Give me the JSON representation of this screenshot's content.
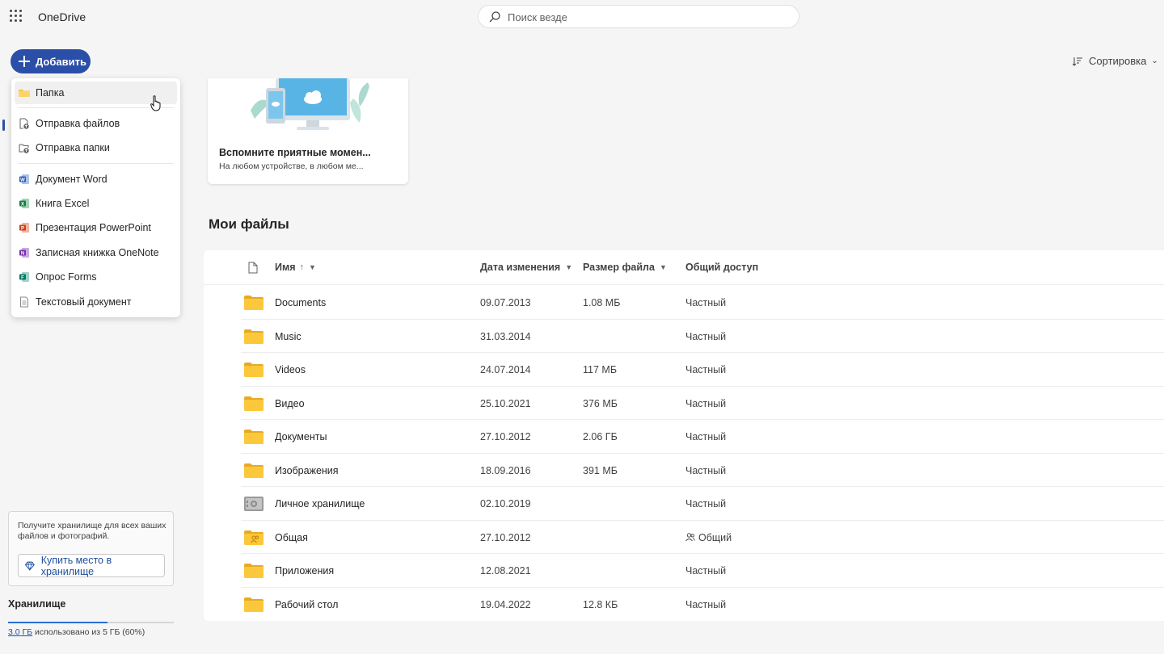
{
  "app": {
    "name": "OneDrive"
  },
  "search": {
    "placeholder": "Поиск везде"
  },
  "toolbar": {
    "add_label": "Добавить",
    "sort_label": "Сортировка"
  },
  "menu": {
    "items": [
      {
        "label": "Папка",
        "icon": "folder-icon"
      },
      {
        "label": "Отправка файлов",
        "icon": "file-upload-icon"
      },
      {
        "label": "Отправка папки",
        "icon": "folder-upload-icon"
      },
      {
        "label": "Документ Word",
        "icon": "word-icon"
      },
      {
        "label": "Книга Excel",
        "icon": "excel-icon"
      },
      {
        "label": "Презентация PowerPoint",
        "icon": "powerpoint-icon"
      },
      {
        "label": "Записная книжка OneNote",
        "icon": "onenote-icon"
      },
      {
        "label": "Опрос Forms",
        "icon": "forms-icon"
      },
      {
        "label": "Текстовый документ",
        "icon": "text-document-icon"
      }
    ]
  },
  "memories": {
    "title": "Вспомните приятные момен...",
    "subtitle": "На любом устройстве, в любом ме..."
  },
  "section_title": "Мои файлы",
  "table": {
    "headers": {
      "name": "Имя",
      "name_sort": "↑",
      "modified": "Дата изменения",
      "size": "Размер файла",
      "sharing": "Общий доступ"
    },
    "rows": [
      {
        "name": "Documents",
        "modified": "09.07.2013",
        "size": "1.08 МБ",
        "sharing": "Частный",
        "icon": "folder-icon"
      },
      {
        "name": "Music",
        "modified": "31.03.2014",
        "size": "",
        "sharing": "Частный",
        "icon": "folder-icon"
      },
      {
        "name": "Videos",
        "modified": "24.07.2014",
        "size": "117 МБ",
        "sharing": "Частный",
        "icon": "folder-icon"
      },
      {
        "name": "Видео",
        "modified": "25.10.2021",
        "size": "376 МБ",
        "sharing": "Частный",
        "icon": "folder-icon"
      },
      {
        "name": "Документы",
        "modified": "27.10.2012",
        "size": "2.06 ГБ",
        "sharing": "Частный",
        "icon": "folder-icon"
      },
      {
        "name": "Изображения",
        "modified": "18.09.2016",
        "size": "391 МБ",
        "sharing": "Частный",
        "icon": "folder-icon"
      },
      {
        "name": "Личное хранилище",
        "modified": "02.10.2019",
        "size": "",
        "sharing": "Частный",
        "icon": "vault-icon"
      },
      {
        "name": "Общая",
        "modified": "27.10.2012",
        "size": "",
        "sharing": "Общий",
        "icon": "shared-folder-icon"
      },
      {
        "name": "Приложения",
        "modified": "12.08.2021",
        "size": "",
        "sharing": "Частный",
        "icon": "folder-icon"
      },
      {
        "name": "Рабочий стол",
        "modified": "19.04.2022",
        "size": "12.8 КБ",
        "sharing": "Частный",
        "icon": "folder-icon"
      }
    ]
  },
  "storage": {
    "promo": "Получите хранилище для всех ваших файлов и фотографий.",
    "buy_label": "Купить место в хранилище",
    "title": "Хранилище",
    "used_link": "3.0 ГБ",
    "used_rest": " использовано из 5 ГБ (60%)",
    "used_fraction": 0.6
  },
  "colors": {
    "accent": "#2b4fa8",
    "folder": "#f8c542",
    "link": "#1e4e9e"
  }
}
